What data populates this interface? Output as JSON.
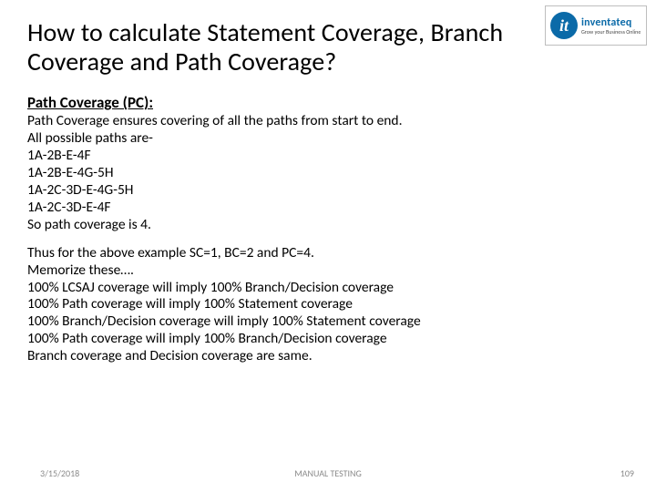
{
  "logo": {
    "mark": "it",
    "name": "inventateq",
    "tag": "Grow your Business Online"
  },
  "title": "How to calculate Statement Coverage, Branch Coverage and Path Coverage?",
  "section_heading": "Path Coverage (PC):",
  "intro_lines": [
    "Path Coverage ensures covering of all the paths from start to end.",
    "All possible paths are-",
    "1A-2B-E-4F",
    "1A-2B-E-4G-5H",
    "1A-2C-3D-E-4G-5H",
    "1A-2C-3D-E-4F",
    "So path coverage is 4."
  ],
  "summary_lines": [
    "Thus for the above example SC=1, BC=2 and PC=4.",
    "Memorize these….",
    "100% LCSAJ coverage will imply 100% Branch/Decision coverage",
    "100% Path coverage will imply 100% Statement coverage",
    "100% Branch/Decision coverage will imply 100% Statement coverage",
    "100% Path coverage will imply 100% Branch/Decision coverage",
    "Branch coverage and Decision coverage are same."
  ],
  "footer": {
    "date": "3/15/2018",
    "center": "MANUAL TESTING",
    "page": "109"
  }
}
